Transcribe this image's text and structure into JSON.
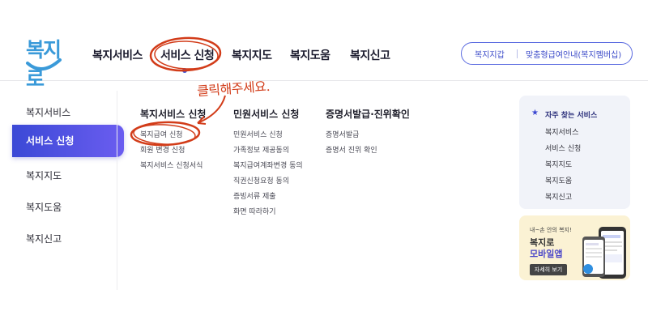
{
  "logo": {
    "text": "복지로"
  },
  "gnb": {
    "items": [
      {
        "label": "복지서비스"
      },
      {
        "label": "서비스 신청"
      },
      {
        "label": "복지지도"
      },
      {
        "label": "복지도움"
      },
      {
        "label": "복지신고"
      }
    ]
  },
  "util": {
    "left": "복지지갑",
    "right": "맞춤형급여안내(복지멤버십)"
  },
  "sidebar": {
    "items": [
      {
        "label": "복지서비스"
      },
      {
        "label": "서비스 신청"
      },
      {
        "label": "복지지도"
      },
      {
        "label": "복지도움"
      },
      {
        "label": "복지신고"
      }
    ]
  },
  "columns": [
    {
      "title": "복지서비스 신청",
      "links": [
        "복지급여 신청",
        "회원 변경 신청",
        "복지서비스 신청서식"
      ]
    },
    {
      "title": "민원서비스 신청",
      "links": [
        "민원서비스 신청",
        "가족정보 제공동의",
        "복지급여계좌변경 동의",
        "직권신청요청 동의",
        "증빙서류 제출",
        "화면 따라하기"
      ]
    },
    {
      "title": "증명서발급·진위확인",
      "links": [
        "증명서발급",
        "증명서 진위 확인"
      ]
    }
  ],
  "favorites": {
    "title": "자주 찾는 서비스",
    "links": [
      "복지서비스",
      "서비스 신청",
      "복지지도",
      "복지도움",
      "복지신고"
    ]
  },
  "app_banner": {
    "small": "내~손 안의 복지!",
    "line1": "복지로",
    "line2": "모바일앱",
    "button": "자세히 보기"
  },
  "annotation": {
    "text": "클릭해주세요."
  },
  "colors": {
    "accent": "#3b49d6",
    "annotation": "#d23c19",
    "logo": "#3a9ad9"
  }
}
